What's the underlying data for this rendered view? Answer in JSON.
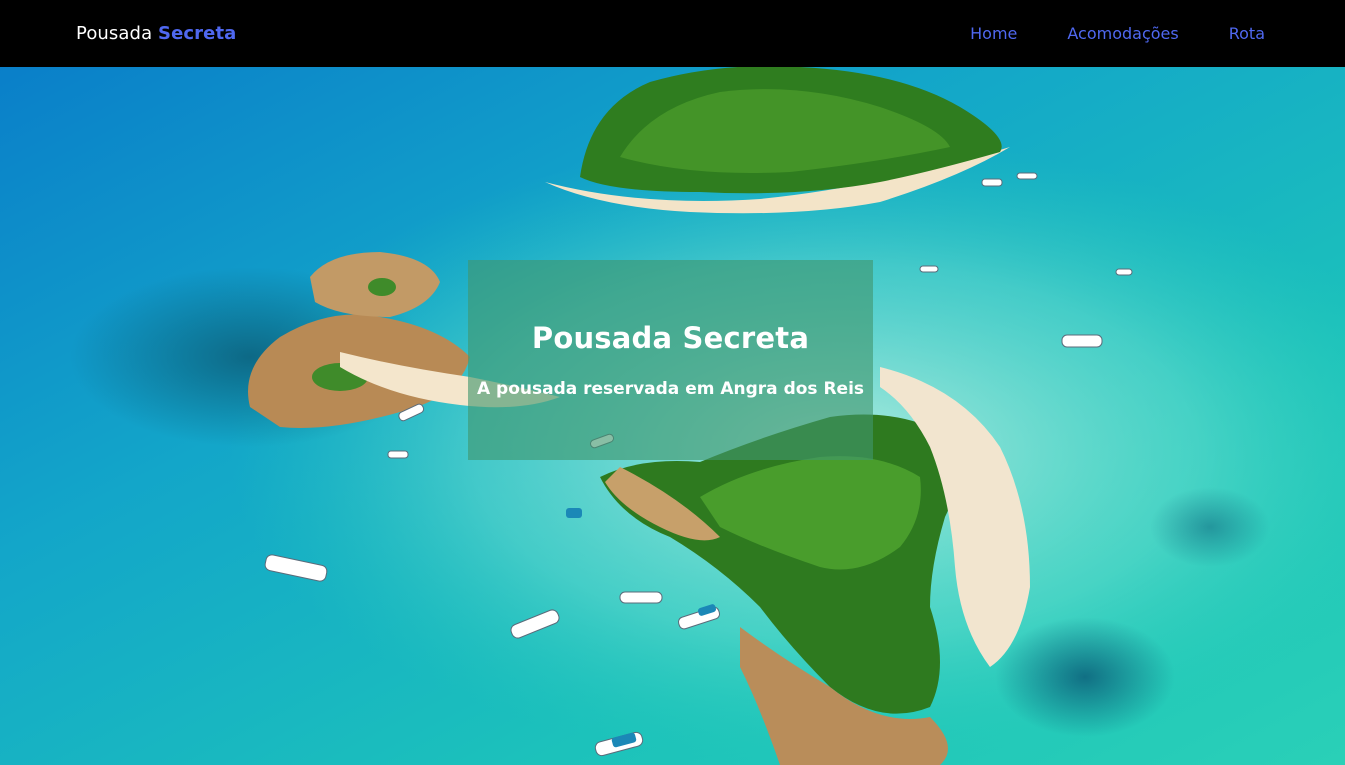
{
  "navbar": {
    "brand": {
      "prefix": "Pousada",
      "accent": "Secreta"
    },
    "links": [
      {
        "label": "Home"
      },
      {
        "label": "Acomodações"
      },
      {
        "label": "Rota"
      }
    ]
  },
  "hero": {
    "title": "Pousada Secreta",
    "subtitle": "A pousada reservada em Angra dos Reis",
    "background_description": "aerial photo of islands with turquoise sea and boats"
  },
  "colors": {
    "navbar_bg": "#000000",
    "accent": "#4f68f0",
    "sea": "#1fb5c8",
    "card": "#40966e"
  }
}
